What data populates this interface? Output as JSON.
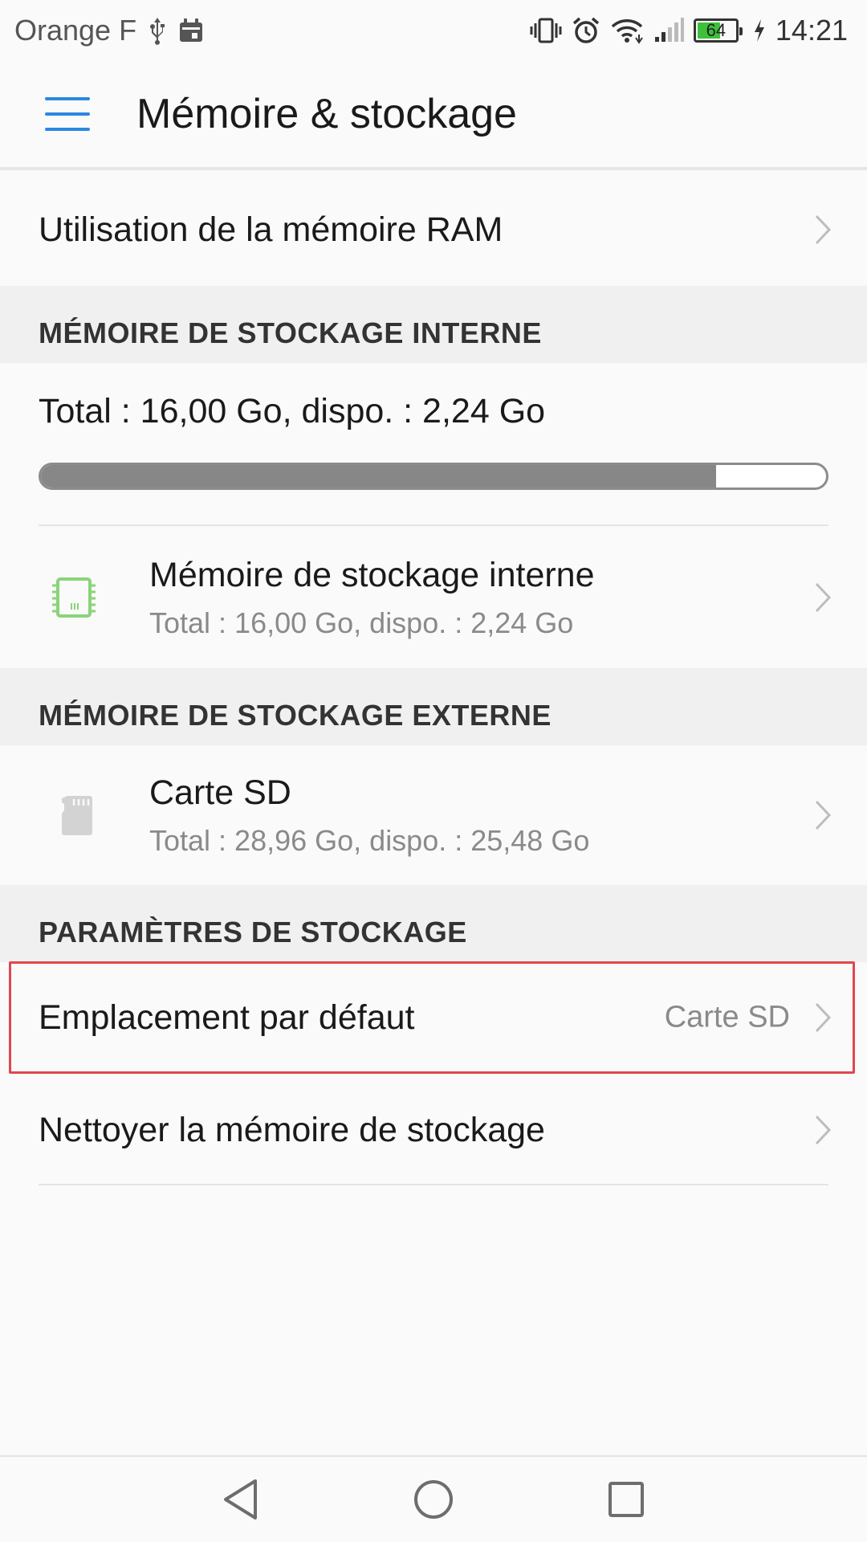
{
  "status_bar": {
    "carrier": "Orange F",
    "battery_level": "64",
    "battery_fraction": 0.64,
    "time": "14:21",
    "icons": [
      "usb-icon",
      "calendar-icon",
      "vibrate-icon",
      "alarm-icon",
      "wifi-icon",
      "signal-icon",
      "battery-icon",
      "charging-icon"
    ]
  },
  "app_bar": {
    "title": "Mémoire & stockage",
    "menu_icon": "menu-icon"
  },
  "ram_row": {
    "label": "Utilisation de la mémoire RAM"
  },
  "internal_section": {
    "header": "MÉMOIRE DE STOCKAGE INTERNE",
    "summary": "Total : 16,00  Go, dispo. : 2,24  Go",
    "used_fraction": 0.86,
    "item": {
      "title": "Mémoire de stockage interne",
      "subtitle": "Total : 16,00  Go, dispo. : 2,24  Go",
      "icon": "chip-icon"
    }
  },
  "external_section": {
    "header": "MÉMOIRE DE STOCKAGE EXTERNE",
    "item": {
      "title": "Carte SD",
      "subtitle": "Total : 28,96  Go, dispo. : 25,48  Go",
      "icon": "sd-card-icon"
    }
  },
  "settings_section": {
    "header": "PARAMÈTRES DE STOCKAGE",
    "default_location": {
      "label": "Emplacement par défaut",
      "value": "Carte SD"
    },
    "clean": {
      "label": "Nettoyer la mémoire de stockage"
    }
  },
  "colors": {
    "accent": "#2a88e0",
    "chip_icon": "#8bd37a",
    "highlight": "#e0474c",
    "progress_fill": "#878787"
  },
  "nav_bar": {
    "icons": [
      "back-icon",
      "home-icon",
      "recents-icon"
    ]
  }
}
